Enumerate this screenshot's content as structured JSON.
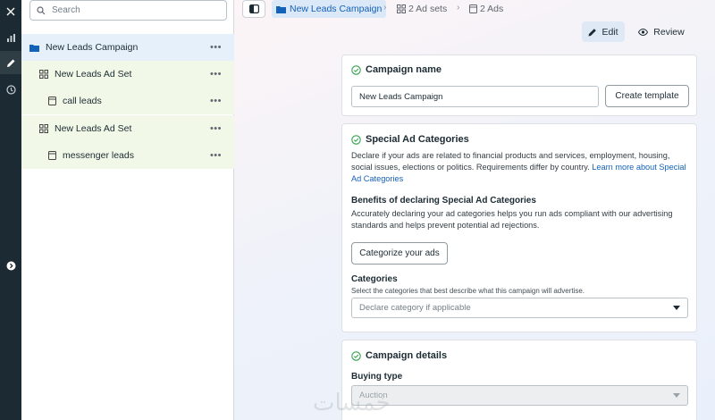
{
  "search": {
    "placeholder": "Search"
  },
  "tree": {
    "campaign": "New Leads Campaign",
    "adset1": "New Leads Ad Set",
    "ad1": "call leads",
    "adset2": "New Leads Ad Set",
    "ad2": "messenger leads",
    "dots": "•••"
  },
  "breadcrumb": {
    "campaign": "New Leads Campaign",
    "adsets": "2 Ad sets",
    "ads": "2 Ads"
  },
  "header": {
    "edit": "Edit",
    "review": "Review"
  },
  "campaign_name": {
    "title": "Campaign name",
    "value": "New Leads Campaign",
    "create_template": "Create template"
  },
  "special": {
    "title": "Special Ad Categories",
    "description": "Declare if your ads are related to financial products and services, employment, housing, social issues, elections or politics. Requirements differ by country.",
    "learn_more": "Learn more about Special Ad Categories",
    "benefits_title": "Benefits of declaring Special Ad Categories",
    "benefits_text": "Accurately declaring your ad categories helps you run ads compliant with our advertising standards and helps prevent potential ad rejections.",
    "categorize_button": "Categorize your ads",
    "categories_label": "Categories",
    "categories_help": "Select the categories that best describe what this campaign will advertise.",
    "categories_placeholder": "Declare category if applicable"
  },
  "details": {
    "title": "Campaign details",
    "buying_type_label": "Buying type",
    "buying_type_value": "Auction"
  },
  "watermark": "خمسات",
  "colors": {
    "accent": "#1461b8",
    "rail": "#1c2b33",
    "success": "#31a24c"
  }
}
